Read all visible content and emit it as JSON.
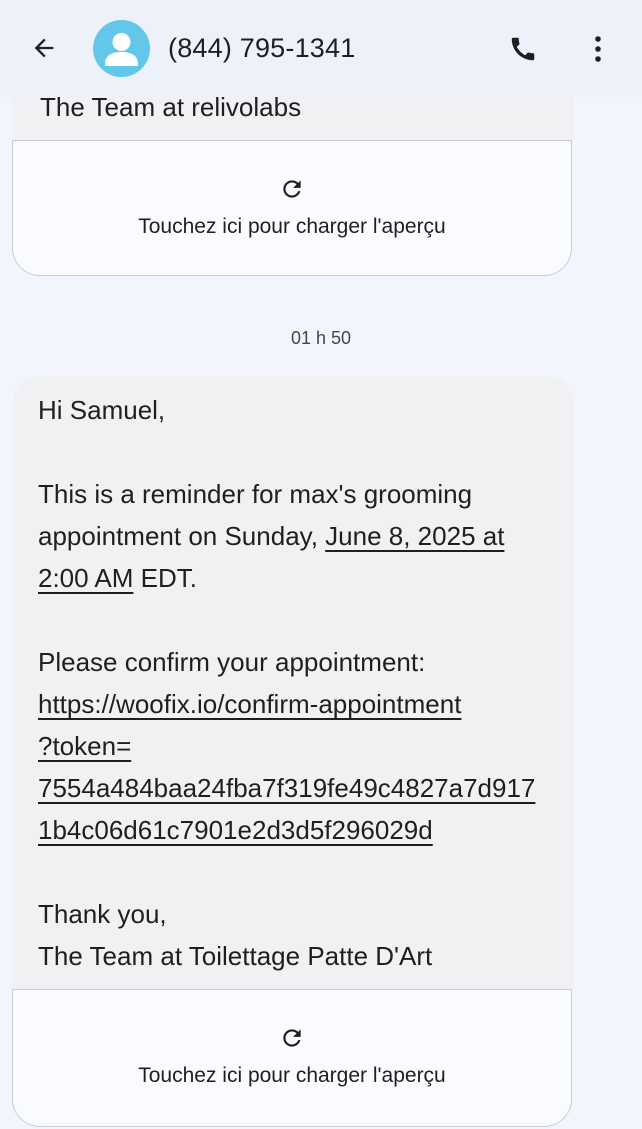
{
  "header": {
    "contact": "(844) 795-1341",
    "back_icon": "arrow-left-icon",
    "call_icon": "phone-icon",
    "more_icon": "more-vert-icon",
    "avatar_color": "#62c7e8"
  },
  "prev_message": {
    "signature": "The Team at relivolabs",
    "preview_label": "Touchez ici pour charger l'aperçu"
  },
  "timestamp": "01 h 50",
  "message": {
    "greeting": "Hi Samuel,",
    "line1": "This is a reminder for max's grooming",
    "line2_prefix": "appointment on Sunday, ",
    "line2_link": "June 8, 2025 at",
    "line3_link": "2:00 AM",
    "line3_suffix": " EDT.",
    "confirm_line": "Please confirm your appointment:",
    "url_line1": "https://woofix.io/confirm-appointment",
    "url_line2": "?token=",
    "url_line3": "7554a484baa24fba7f319fe49c4827a7d917",
    "url_line4": "1b4c06d61c7901e2d3d5f296029d",
    "thanks": "Thank you,",
    "signature": "The Team at Toilettage Patte D'Art",
    "preview_label": "Touchez ici pour charger l'aperçu"
  }
}
